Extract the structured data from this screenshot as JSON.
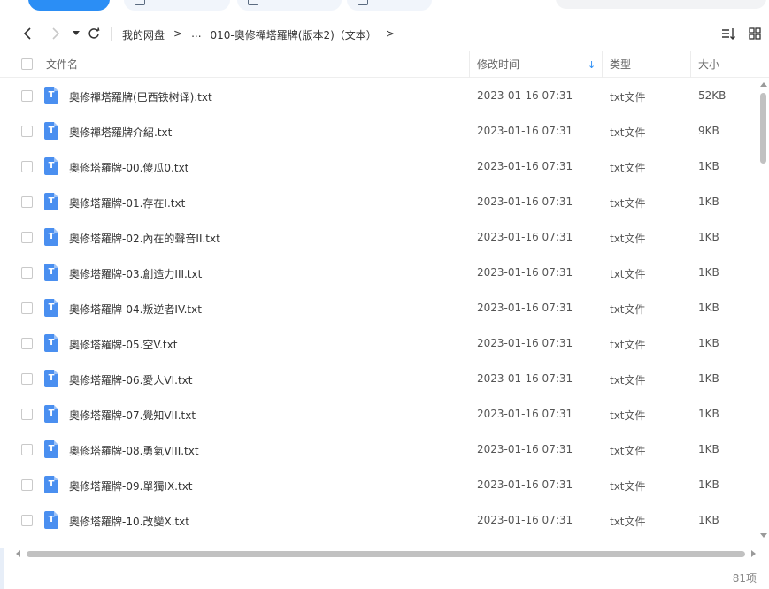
{
  "breadcrumb": {
    "root": "我的网盘",
    "sep1": ">",
    "ellipsis": "...",
    "current": "010-奧修禪塔羅牌(版本2)（文本）",
    "sep2": ">"
  },
  "columns": {
    "name": "文件名",
    "modified": "修改时间",
    "type": "类型",
    "size": "大小"
  },
  "icons": {
    "back": "chevron-left-icon",
    "forward": "chevron-right-icon",
    "dropdown": "caret-down-icon",
    "refresh": "refresh-icon",
    "sort": "sort-icon",
    "grid": "grid-view-icon",
    "file": "txt-file-icon",
    "file_glyph": "T"
  },
  "accent_color": "#2b8ef5",
  "files": [
    {
      "name": "奧修禪塔羅牌(巴西铁树译).txt",
      "modified": "2023-01-16 07:31",
      "type": "txt文件",
      "size": "52KB"
    },
    {
      "name": "奧修禪塔羅牌介紹.txt",
      "modified": "2023-01-16 07:31",
      "type": "txt文件",
      "size": "9KB"
    },
    {
      "name": "奧修塔羅牌-00.傻瓜0.txt",
      "modified": "2023-01-16 07:31",
      "type": "txt文件",
      "size": "1KB"
    },
    {
      "name": "奧修塔羅牌-01.存在I.txt",
      "modified": "2023-01-16 07:31",
      "type": "txt文件",
      "size": "1KB"
    },
    {
      "name": "奧修塔羅牌-02.內在的聲音II.txt",
      "modified": "2023-01-16 07:31",
      "type": "txt文件",
      "size": "1KB"
    },
    {
      "name": "奧修塔羅牌-03.創造力III.txt",
      "modified": "2023-01-16 07:31",
      "type": "txt文件",
      "size": "1KB"
    },
    {
      "name": "奧修塔羅牌-04.叛逆者IV.txt",
      "modified": "2023-01-16 07:31",
      "type": "txt文件",
      "size": "1KB"
    },
    {
      "name": "奧修塔羅牌-05.空V.txt",
      "modified": "2023-01-16 07:31",
      "type": "txt文件",
      "size": "1KB"
    },
    {
      "name": "奧修塔羅牌-06.愛人VI.txt",
      "modified": "2023-01-16 07:31",
      "type": "txt文件",
      "size": "1KB"
    },
    {
      "name": "奧修塔羅牌-07.覺知VII.txt",
      "modified": "2023-01-16 07:31",
      "type": "txt文件",
      "size": "1KB"
    },
    {
      "name": "奧修塔羅牌-08.勇氣VIII.txt",
      "modified": "2023-01-16 07:31",
      "type": "txt文件",
      "size": "1KB"
    },
    {
      "name": "奧修塔羅牌-09.單獨IX.txt",
      "modified": "2023-01-16 07:31",
      "type": "txt文件",
      "size": "1KB"
    },
    {
      "name": "奧修塔羅牌-10.改變X.txt",
      "modified": "2023-01-16 07:31",
      "type": "txt文件",
      "size": "1KB"
    }
  ],
  "status": {
    "count": "81项"
  }
}
